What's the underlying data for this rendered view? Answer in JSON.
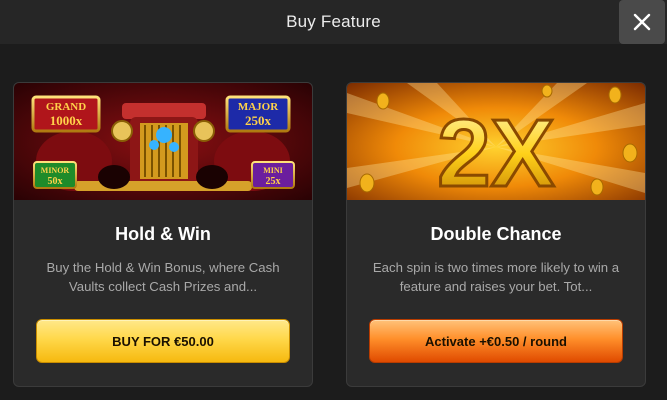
{
  "header": {
    "title": "Buy Feature"
  },
  "icons": {
    "close": "close-icon"
  },
  "cards": [
    {
      "banner": {
        "grand_label": "GRAND",
        "grand_value": "1000x",
        "major_label": "MAJOR",
        "major_value": "250x",
        "minor_label": "MINOR",
        "minor_value": "50x",
        "mini_label": "MINI",
        "mini_value": "25x"
      },
      "title": "Hold & Win",
      "description": "Buy the Hold & Win Bonus, where Cash Vaults collect Cash Prizes and...",
      "button_label": "BUY FOR €50.00"
    },
    {
      "banner": {
        "multiplier": "2X"
      },
      "title": "Double Chance",
      "description": "Each spin is two times more likely to win a feature and raises your bet. Tot...",
      "button_label": "Activate +€0.50 / round"
    }
  ],
  "colors": {
    "background": "#1c1c1c",
    "header": "#262626",
    "card": "#2a2a2a",
    "yellow_button": "#ffd84a",
    "orange_button": "#ff8f2a"
  }
}
